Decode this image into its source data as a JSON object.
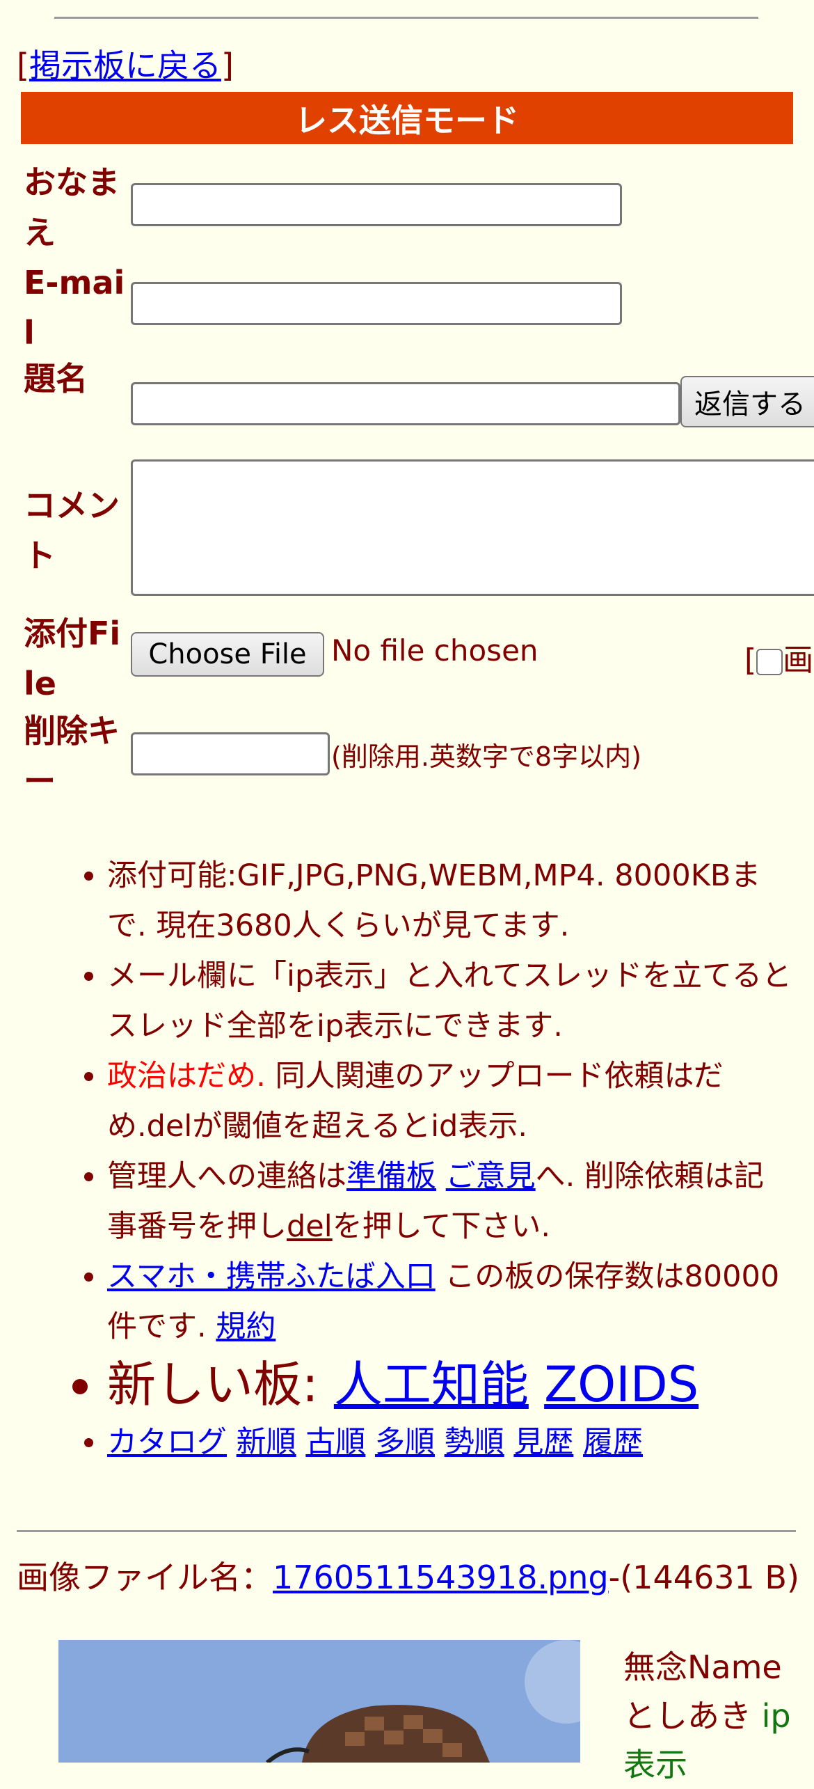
{
  "back": {
    "open": "[",
    "link": "掲示板に戻る",
    "close": "]"
  },
  "mode_title": "レス送信モード",
  "form": {
    "name_label": "おなまえ",
    "email_label": "E-mail",
    "subject_label": "題名",
    "submit_label": "返信する",
    "comment_label": "コメント",
    "file_label": "添付File",
    "choose_file": "Choose File",
    "no_file": "No file chosen",
    "draw_prefix": "[",
    "draw_text": "画",
    "delkey_label": "削除キー",
    "delkey_hint": "(削除用.英数字で8字以内)"
  },
  "rules": {
    "r1": "添付可能:GIF,JPG,PNG,WEBM,MP4. 8000KBまで. 現在3680人くらいが見てます.",
    "r2": "メール欄に「ip表示」と入れてスレッドを立てるとスレッド全部をip表示にできます.",
    "r3_red": "政治はだめ.",
    "r3_rest": " 同人関連のアップロード依頼はだめ.delが閾値を超えるとid表示.",
    "r4_a": "管理人への連絡は",
    "r4_link1": "準備板",
    "r4_space": " ",
    "r4_link2": "ご意見",
    "r4_b": "へ. 削除依頼は記事番号を押し",
    "r4_link3": "del",
    "r4_c": "を押して下さい.",
    "r5_link": "スマホ・携帯ふたば入口",
    "r5_rest": " この板の保存数は80000件です. ",
    "r5_link2": "規約",
    "r6_prefix": "新しい板: ",
    "r6_link1": "人工知能",
    "r6_link2": "ZOIDS",
    "nav": [
      "カタログ",
      "新順",
      "古順",
      "多順",
      "勢順",
      "見歴",
      "履歴"
    ]
  },
  "post": {
    "img_prefix": "画像ファイル名：",
    "img_link": "1760511543918.png",
    "img_size": "-(144631 B)",
    "name_line1": "無念Name",
    "name_line2": "としあき ",
    "ip_label": "ip表示"
  }
}
